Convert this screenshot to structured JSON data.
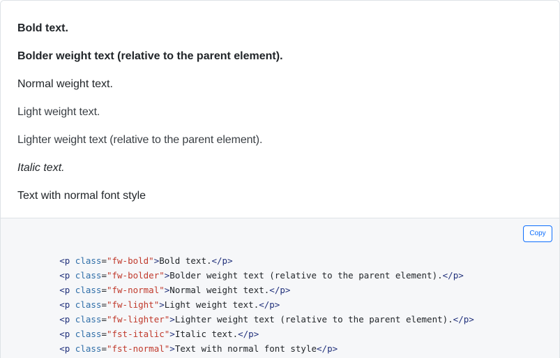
{
  "example": {
    "lines": [
      {
        "text": "Bold text."
      },
      {
        "text": "Bolder weight text (relative to the parent element)."
      },
      {
        "text": "Normal weight text."
      },
      {
        "text": "Light weight text."
      },
      {
        "text": "Lighter weight text (relative to the parent element)."
      },
      {
        "text": "Italic text."
      },
      {
        "text": "Text with normal font style"
      }
    ]
  },
  "code": {
    "copy_label": "Copy",
    "lines": [
      {
        "open": "<p ",
        "attr": "class",
        "eq": "=",
        "value": "\"fw-bold\"",
        "close_open": ">",
        "content": "Bold text.",
        "close": "</p>"
      },
      {
        "open": "<p ",
        "attr": "class",
        "eq": "=",
        "value": "\"fw-bolder\"",
        "close_open": ">",
        "content": "Bolder weight text (relative to the parent element).",
        "close": "</p>"
      },
      {
        "open": "<p ",
        "attr": "class",
        "eq": "=",
        "value": "\"fw-normal\"",
        "close_open": ">",
        "content": "Normal weight text.",
        "close": "</p>"
      },
      {
        "open": "<p ",
        "attr": "class",
        "eq": "=",
        "value": "\"fw-light\"",
        "close_open": ">",
        "content": "Light weight text.",
        "close": "</p>"
      },
      {
        "open": "<p ",
        "attr": "class",
        "eq": "=",
        "value": "\"fw-lighter\"",
        "close_open": ">",
        "content": "Lighter weight text (relative to the parent element).",
        "close": "</p>"
      },
      {
        "open": "<p ",
        "attr": "class",
        "eq": "=",
        "value": "\"fst-italic\"",
        "close_open": ">",
        "content": "Italic text.",
        "close": "</p>"
      },
      {
        "open": "<p ",
        "attr": "class",
        "eq": "=",
        "value": "\"fst-normal\"",
        "close_open": ">",
        "content": "Text with normal font style",
        "close": "</p>"
      }
    ]
  }
}
